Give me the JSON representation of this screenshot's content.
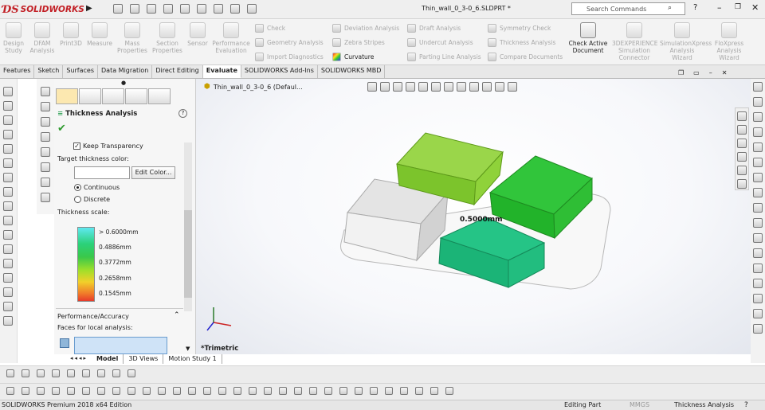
{
  "app": {
    "brand": "SOLIDWORKS",
    "document_title": "Thin_wall_0_3-0_6.SLDPRT *",
    "search_placeholder": "Search Commands"
  },
  "ribbon": {
    "big_buttons": [
      {
        "label": "Design Study"
      },
      {
        "label": "DFAM Analysis"
      },
      {
        "label": "Print3D"
      },
      {
        "label": "Measure"
      },
      {
        "label": "Mass Properties"
      },
      {
        "label": "Section Properties"
      },
      {
        "label": "Sensor"
      },
      {
        "label": "Performance Evaluation"
      }
    ],
    "small_buttons": [
      {
        "label": "Check"
      },
      {
        "label": "Geometry Analysis"
      },
      {
        "label": "Import Diagnostics"
      },
      {
        "label": "Deviation Analysis"
      },
      {
        "label": "Zebra Stripes"
      },
      {
        "label": "Curvature"
      },
      {
        "label": "Draft Analysis"
      },
      {
        "label": "Undercut Analysis"
      },
      {
        "label": "Parting Line Analysis"
      },
      {
        "label": "Symmetry Check"
      },
      {
        "label": "Thickness Analysis"
      },
      {
        "label": "Compare Documents"
      }
    ],
    "right_buttons": [
      {
        "label": "Check Active Document"
      },
      {
        "label": "3DEXPERIENCE Simulation Connector"
      },
      {
        "label": "SimulationXpress Analysis Wizard"
      },
      {
        "label": "FloXpress Analysis Wizard"
      }
    ]
  },
  "tabs": [
    "Features",
    "Sketch",
    "Surfaces",
    "Data Migration",
    "Direct Editing",
    "Evaluate",
    "SOLIDWORKS Add-Ins",
    "SOLIDWORKS MBD"
  ],
  "active_tab": "Evaluate",
  "property_manager": {
    "title": "Thickness Analysis",
    "keep_transparency": "Keep Transparency",
    "target_color_label": "Target thickness color:",
    "edit_color": "Edit Color...",
    "continuous": "Continuous",
    "discrete": "Discrete",
    "scale_label": "Thickness scale:",
    "scale_values": [
      "> 0.6000mm",
      "0.4886mm",
      "0.3772mm",
      "0.2658mm",
      "0.1545mm"
    ],
    "perf_header": "Performance/Accuracy",
    "faces_label": "Faces for local analysis:"
  },
  "viewport": {
    "tree_label": "Thin_wall_0_3-0_6  (Defaul...",
    "thickness_callout": "0.5000mm",
    "view_name": "*Trimetric"
  },
  "model_tabs": [
    "Model",
    "3D Views",
    "Motion Study 1"
  ],
  "status": {
    "edition": "SOLIDWORKS Premium 2018 x64 Edition",
    "mode": "Editing Part",
    "units": "MMGS",
    "tool": "Thickness Analysis"
  }
}
